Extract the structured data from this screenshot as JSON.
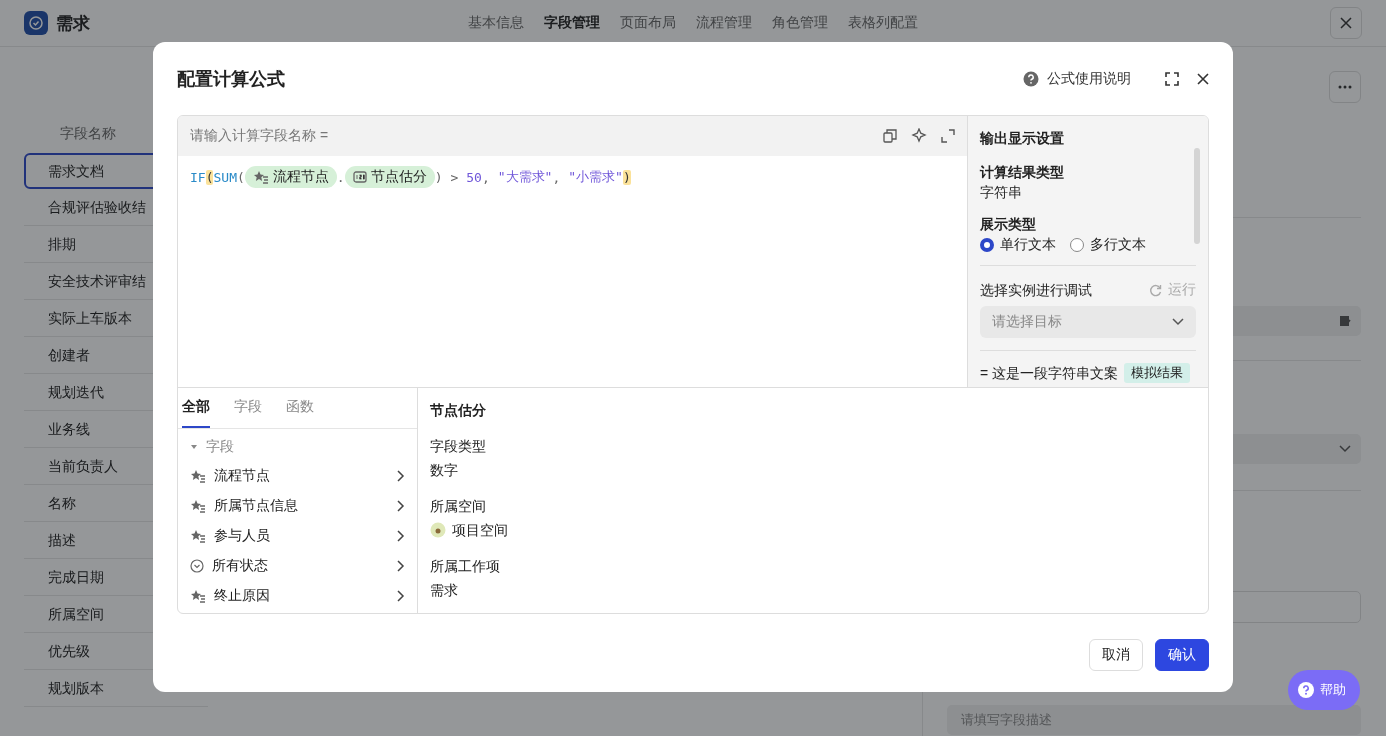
{
  "app": {
    "title": "需求",
    "tabs": [
      {
        "label": "基本信息",
        "selected": false
      },
      {
        "label": "字段管理",
        "selected": true
      },
      {
        "label": "页面布局",
        "selected": false
      },
      {
        "label": "流程管理",
        "selected": false
      },
      {
        "label": "角色管理",
        "selected": false
      },
      {
        "label": "表格列配置",
        "selected": false
      }
    ]
  },
  "field_table": {
    "header": "字段名称",
    "rows": [
      {
        "name": "需求文档",
        "selected": true
      },
      {
        "name": "合规评估验收结",
        "selected": false
      },
      {
        "name": "排期",
        "selected": false
      },
      {
        "name": "安全技术评审结",
        "selected": false
      },
      {
        "name": "实际上车版本",
        "selected": false
      },
      {
        "name": "创建者",
        "selected": false
      },
      {
        "name": "规划迭代",
        "selected": false
      },
      {
        "name": "业务线",
        "selected": false
      },
      {
        "name": "当前负责人",
        "selected": false
      },
      {
        "name": "名称",
        "selected": false
      },
      {
        "name": "描述",
        "selected": false
      },
      {
        "name": "完成日期",
        "selected": false
      },
      {
        "name": "所属空间",
        "selected": false
      },
      {
        "name": "优先级",
        "selected": false
      },
      {
        "name": "规划版本",
        "selected": false
      }
    ]
  },
  "side_panel": {
    "description_placeholder": "请填写字段描述"
  },
  "help_button": {
    "label": "帮助"
  },
  "dialog": {
    "title": "配置计算公式",
    "help_link": "公式使用说明",
    "name_placeholder": "请输入计算字段名称",
    "equals": "=",
    "formula": [
      {
        "kind": "func",
        "text": "IF"
      },
      {
        "kind": "punct",
        "text": "(",
        "highlighted": true
      },
      {
        "kind": "func",
        "text": "SUM"
      },
      {
        "kind": "punct",
        "text": "(",
        "highlighted": false
      },
      {
        "kind": "node_field",
        "text": "流程节点"
      },
      {
        "kind": "punct",
        "text": ".",
        "highlighted": false
      },
      {
        "kind": "number_field",
        "text": "节点估分"
      },
      {
        "kind": "punct",
        "text": ")",
        "highlighted": false
      },
      {
        "kind": "punct",
        "text": ">",
        "highlighted": false
      },
      {
        "kind": "number",
        "text": "50"
      },
      {
        "kind": "punct",
        "text": ",",
        "highlighted": false
      },
      {
        "kind": "string",
        "text": "\"大需求\""
      },
      {
        "kind": "punct",
        "text": ",",
        "highlighted": false
      },
      {
        "kind": "string",
        "text": "\"小需求\""
      },
      {
        "kind": "punct",
        "text": ")",
        "highlighted": true
      }
    ],
    "output_settings": {
      "title": "输出显示设置",
      "result_type_label": "计算结果类型",
      "result_type": "字符串",
      "display_type_label": "展示类型",
      "display_options": [
        {
          "label": "单行文本",
          "selected": true
        },
        {
          "label": "多行文本",
          "selected": false
        }
      ]
    },
    "debug": {
      "label": "选择实例进行调试",
      "run": "运行",
      "select_placeholder": "请选择目标",
      "result": "= 这是一段字符串文案",
      "result_tag": "模拟结果"
    },
    "tabs": [
      {
        "label": "全部",
        "selected": true
      },
      {
        "label": "字段",
        "selected": false
      },
      {
        "label": "函数",
        "selected": false
      }
    ],
    "tree": [
      {
        "label": "字段",
        "expanded": true,
        "children": [
          {
            "label": "流程节点",
            "kind": "node"
          },
          {
            "label": "所属节点信息",
            "kind": "node"
          },
          {
            "label": "参与人员",
            "kind": "node"
          },
          {
            "label": "所有状态",
            "kind": "status"
          },
          {
            "label": "终止原因",
            "kind": "node"
          }
        ]
      }
    ],
    "detail": {
      "title": "节点估分",
      "sections": [
        {
          "label": "字段类型",
          "value": "数字",
          "kind": "text"
        },
        {
          "label": "所属空间",
          "value": "项目空间",
          "kind": "space"
        },
        {
          "label": "所属工作项",
          "value": "需求",
          "kind": "text"
        }
      ]
    },
    "buttons": [
      {
        "label": "取消",
        "kind": "secondary"
      },
      {
        "label": "确认",
        "kind": "primary"
      }
    ]
  }
}
